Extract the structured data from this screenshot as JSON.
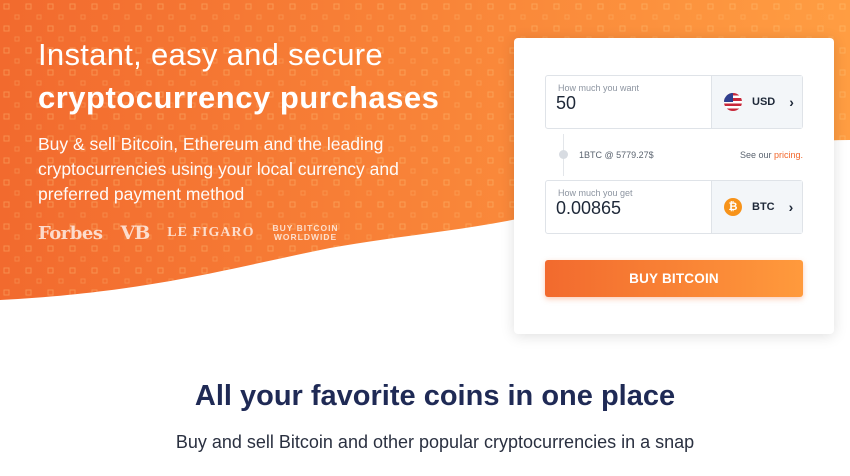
{
  "hero": {
    "headline_line1": "Instant, easy and secure",
    "headline_line2": "cryptocurrency purchases",
    "subtext": "Buy & sell Bitcoin, Ethereum and the leading cryptocurrencies using your local currency and preferred payment method",
    "press_logos": [
      "Forbes",
      "VB",
      "LE FIGARO",
      "BUY BITCOIN",
      "WORLDWIDE"
    ]
  },
  "converter": {
    "want_label": "How much you want",
    "want_value": "50",
    "want_currency": "USD",
    "want_currency_icon": "us-flag-icon",
    "rate": "1BTC @ 5779.27$",
    "pricing_prefix": "See our ",
    "pricing_link": "pricing.",
    "get_label": "How much you get",
    "get_value": "0.00865",
    "get_currency": "BTC",
    "get_currency_icon": "bitcoin-icon",
    "buy_button": "BUY BITCOIN"
  },
  "section": {
    "title": "All your favorite coins in one place",
    "subtitle": "Buy and sell Bitcoin and other popular cryptocurrencies in a snap"
  },
  "colors": {
    "brand_orange": "#f2662a",
    "brand_orange_light": "#ff9a3c",
    "heading_navy": "#1f2a55"
  }
}
